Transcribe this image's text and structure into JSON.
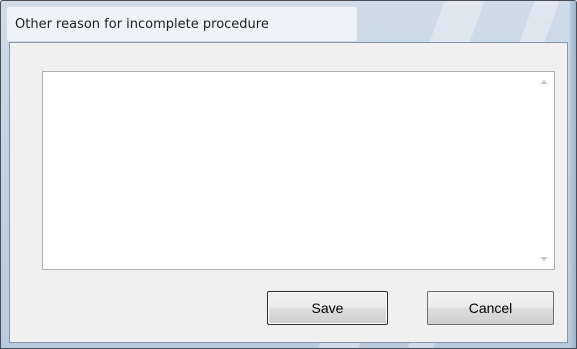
{
  "window": {
    "title": "Other reason for incomplete procedure"
  },
  "reason_field": {
    "value": ""
  },
  "buttons": {
    "save_label": "Save",
    "cancel_label": "Cancel"
  },
  "colors": {
    "frame": "#c4d3e3",
    "client_background": "#f0f0f0",
    "field_background": "#ffffff"
  }
}
